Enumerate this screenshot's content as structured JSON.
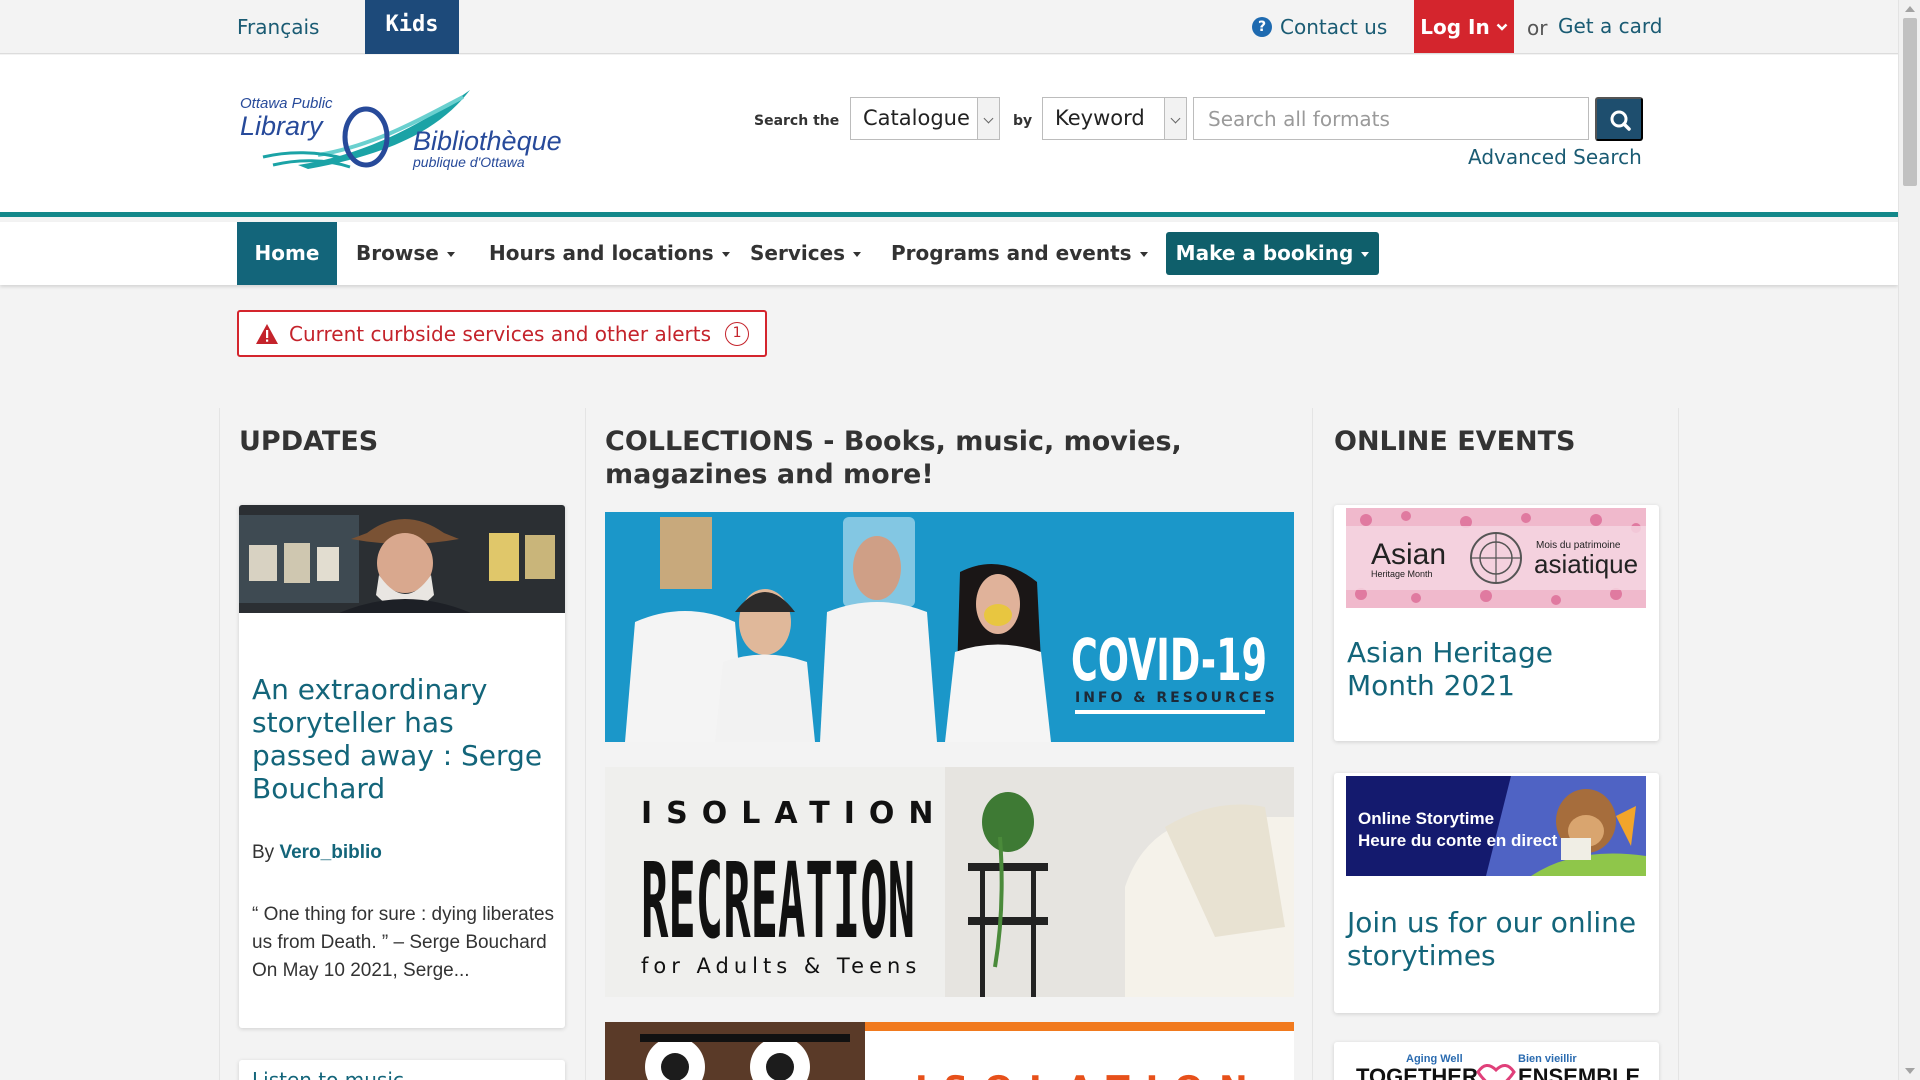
{
  "topbar": {
    "language_link": "Français",
    "kids_label": "Kids",
    "contact_label": "Contact us",
    "login_label": "Log In",
    "or_text": "or",
    "get_card_label": "Get a card"
  },
  "header": {
    "logo": {
      "line1": "Ottawa Public",
      "line2": "Library",
      "line3": "Bibliothèque",
      "line4": "publique d'Ottawa"
    },
    "search_the_label": "Search the",
    "catalogue_select": "Catalogue",
    "by_label": "by",
    "keyword_select": "Keyword",
    "search_placeholder": "Search all formats",
    "advanced_search_label": "Advanced Search"
  },
  "nav": {
    "home": "Home",
    "browse": "Browse",
    "hours": "Hours and locations",
    "services": "Services",
    "programs": "Programs and events",
    "booking": "Make a booking"
  },
  "alert": {
    "text": "Current curbside services and other alerts",
    "count": "1"
  },
  "updates": {
    "heading": "UPDATES",
    "post": {
      "title": "An extraordinary storyteller has passed away : Serge Bouchard",
      "by_label": "By",
      "author": "Vero_biblio",
      "excerpt": "“ One thing for sure : dying liberates us from Death. ” – Serge Bouchard On May 10 2021, Serge..."
    },
    "next_post_title": "Listen to music"
  },
  "collections": {
    "heading": "COLLECTIONS - Books, music, movies, magazines and more!",
    "covid": {
      "title": "COVID-19",
      "subtitle": "INFO & RESOURCES"
    },
    "isolation": {
      "line1": "ISOLATION",
      "line2": "RECREATION",
      "line3": "for Adults & Teens"
    },
    "third": {
      "text": "ISOLATION"
    }
  },
  "online_events": {
    "heading": "ONLINE EVENTS",
    "asian": {
      "title": "Asian Heritage Month 2021",
      "banner_left": "Asian",
      "banner_left_small": "Heritage Month",
      "banner_right_small": "Mois du patrimoine",
      "banner_right": "asiatique"
    },
    "storytime": {
      "title": "Join us for our online storytimes",
      "banner_line1": "Online Storytime",
      "banner_line2": "Heure du conte en direct"
    },
    "aging": {
      "small_left": "Aging Well",
      "small_right": "Bien vieillir",
      "big_left": "TOGETHER",
      "big_right": "ENSEMBLE"
    }
  },
  "colors": {
    "brand_teal": "#13657a",
    "alert_red": "#d4252d",
    "kids_blue": "#1d4a7a"
  }
}
